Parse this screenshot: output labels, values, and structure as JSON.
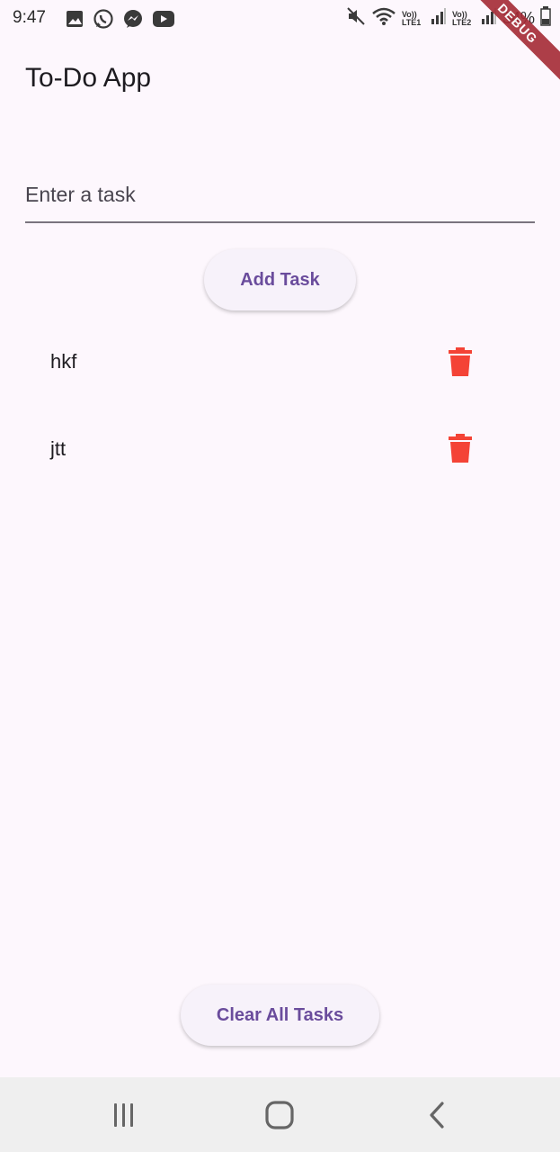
{
  "status": {
    "time": "9:47",
    "network1": "Vo)) LTE1",
    "network2": "Vo)) LTE2",
    "battery": "34%",
    "icons": [
      "image-icon",
      "whatsapp-icon",
      "messenger-icon",
      "youtube-icon",
      "mute-icon",
      "wifi-icon",
      "signal-icon",
      "battery-icon"
    ]
  },
  "debug_banner": "DEBUG",
  "app": {
    "title": "To-Do App",
    "input_placeholder": "Enter a task",
    "add_button": "Add Task",
    "clear_button": "Clear All Tasks"
  },
  "tasks": [
    {
      "label": "hkf"
    },
    {
      "label": "jtt"
    }
  ],
  "colors": {
    "background": "#fdf7fd",
    "accent": "#6a4c9c",
    "delete": "#f44336"
  }
}
